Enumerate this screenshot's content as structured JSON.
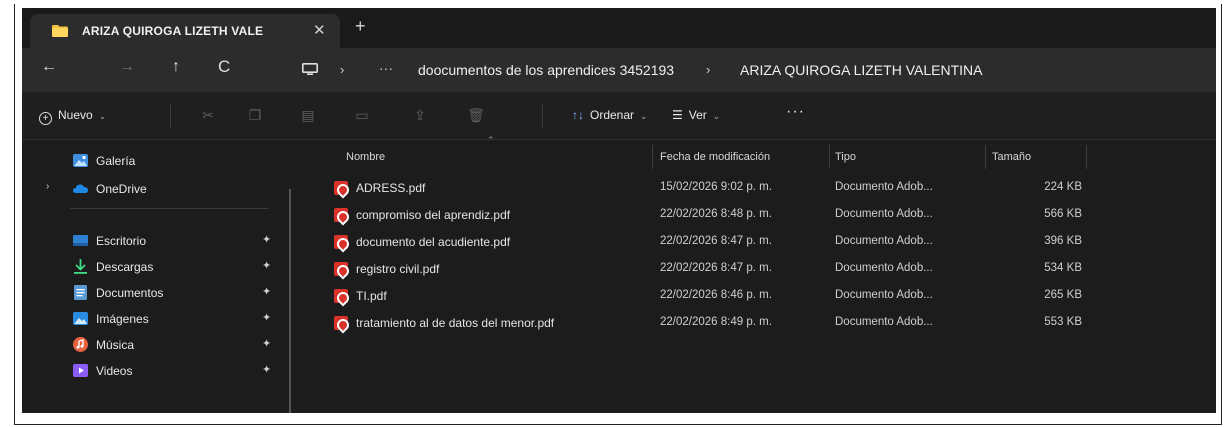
{
  "colors": {
    "window_bg": "#1c1c1c",
    "tab_active": "#2c2c2c",
    "folder_yellow": "#f5c342",
    "pdf_red": "#d9322b",
    "onedrive_blue": "#1e88e5"
  },
  "tab": {
    "title": "ARIZA QUIROGA LIZETH VALE",
    "close": "✕",
    "new": "+"
  },
  "nav": {
    "back": "←",
    "forward": "→",
    "up": "↑",
    "refresh": "C"
  },
  "address": {
    "sep": "›",
    "more": "···",
    "crumbs": [
      "doocumentos de los aprendices 3452193",
      "ARIZA QUIROGA LIZETH VALENTINA"
    ]
  },
  "commands": {
    "new": "Nuevo",
    "sort": "Ordenar",
    "view": "Ver",
    "more": "···",
    "sort_icon": "↑↓",
    "view_icon": "☰",
    "caret": "⌄"
  },
  "sidebar": {
    "pin": "📌",
    "expand": "›",
    "items": [
      {
        "label": "Galería",
        "icon": "gallery-icon"
      },
      {
        "label": "OneDrive",
        "icon": "onedrive-icon"
      },
      {
        "label": "Escritorio",
        "icon": "desktop-icon"
      },
      {
        "label": "Descargas",
        "icon": "download-icon"
      },
      {
        "label": "Documentos",
        "icon": "documents-icon"
      },
      {
        "label": "Imágenes",
        "icon": "pictures-icon"
      },
      {
        "label": "Música",
        "icon": "music-icon"
      },
      {
        "label": "Videos",
        "icon": "videos-icon"
      }
    ]
  },
  "files": {
    "columns": [
      "Nombre",
      "Fecha de modificación",
      "Tipo",
      "Tamaño"
    ],
    "rows": [
      {
        "name": "ADRESS.pdf",
        "date": "15/02/2026 9:02 p. m.",
        "type": "Documento Adob...",
        "size": "224 KB"
      },
      {
        "name": "compromiso del aprendiz.pdf",
        "date": "22/02/2026 8:48 p. m.",
        "type": "Documento Adob...",
        "size": "566 KB"
      },
      {
        "name": "documento del acudiente.pdf",
        "date": "22/02/2026 8:47 p. m.",
        "type": "Documento Adob...",
        "size": "396 KB"
      },
      {
        "name": "registro civil.pdf",
        "date": "22/02/2026 8:47 p. m.",
        "type": "Documento Adob...",
        "size": "534 KB"
      },
      {
        "name": "TI.pdf",
        "date": "22/02/2026 8:46 p. m.",
        "type": "Documento Adob...",
        "size": "265 KB"
      },
      {
        "name": "tratamiento al de datos del menor.pdf",
        "date": "22/02/2026 8:49 p. m.",
        "type": "Documento Adob...",
        "size": "553 KB"
      }
    ]
  }
}
